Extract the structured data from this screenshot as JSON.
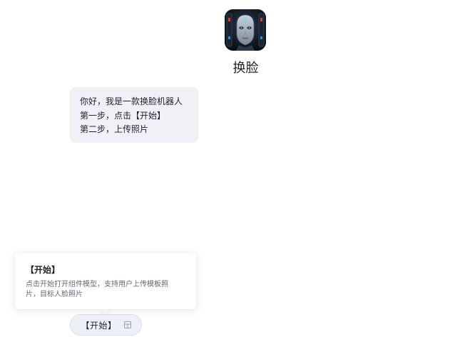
{
  "bot": {
    "name": "换脸",
    "avatar_icon": "robot-face-avatar"
  },
  "message": {
    "lines": [
      "你好，我是一款换脸机器人",
      "第一步，点击【开始】",
      "第二步，上传照片"
    ]
  },
  "tooltip": {
    "title": "【开始】",
    "description_line1": "点击开始打开组件模型，支持用户上传模板照",
    "description_line2": "片，目标人脸照片"
  },
  "command_chip": {
    "label": "【开始】",
    "icon": "component-icon"
  },
  "colors": {
    "bubble_background": "#f0f1f6",
    "chip_background": "#eef0f7",
    "text_primary": "#1f2329",
    "text_secondary": "#646a73"
  }
}
